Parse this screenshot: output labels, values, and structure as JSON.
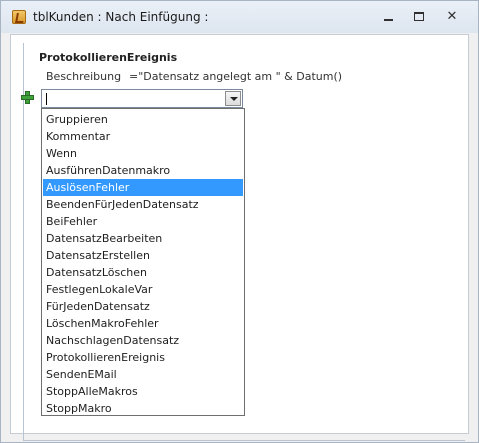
{
  "window": {
    "title": "tblKunden : Nach Einfügung :"
  },
  "titlebar": {
    "minimize_glyph": "",
    "maximize_glyph": "",
    "close_glyph": "✕"
  },
  "macro": {
    "action_name": "ProtokollierenEreignis",
    "argument_label": "Beschreibung",
    "argument_value": "=\"Datensatz angelegt am \" & Datum()"
  },
  "new_action": {
    "input_value": "",
    "selected_index": 4
  },
  "dropdown": {
    "items": [
      "Gruppieren",
      "Kommentar",
      "Wenn",
      "AusführenDatenmakro",
      "AuslösenFehler",
      "BeendenFürJedenDatensatz",
      "BeiFehler",
      "DatensatzBearbeiten",
      "DatensatzErstellen",
      "DatensatzLöschen",
      "FestlegenLokaleVar",
      "FürJedenDatensatz",
      "LöschenMakroFehler",
      "NachschlagenDatensatz",
      "ProtokollierenEreignis",
      "SendenEMail",
      "StoppAlleMakros",
      "StoppMakro"
    ]
  },
  "icons": {
    "app": "access-macro-icon",
    "add": "add-green-plus-icon",
    "combo": "chevron-down-icon"
  }
}
